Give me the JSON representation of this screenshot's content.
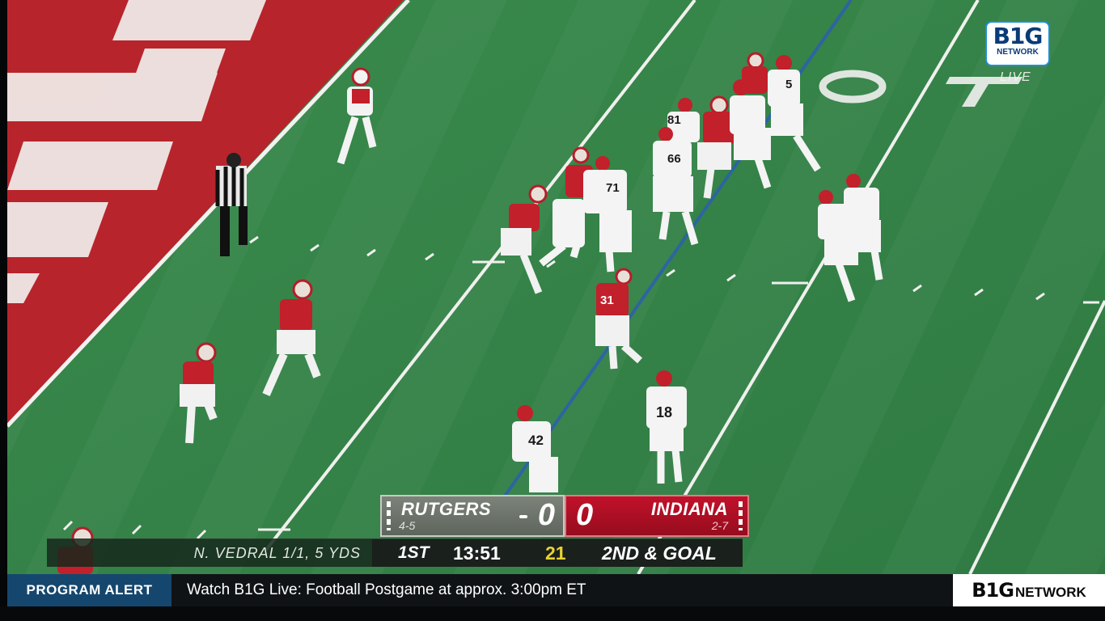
{
  "scorebug": {
    "away": {
      "name": "RUTGERS",
      "record": "4-5",
      "score": "0"
    },
    "home": {
      "name": "INDIANA",
      "record": "2-7",
      "score": "0"
    },
    "quarter": "1ST",
    "clock": "13:51",
    "play_clock": "21",
    "down_distance": "2ND & GOAL",
    "stat_line": "N. VEDRAL 1/1, 5 YDS"
  },
  "network": {
    "logo_main": "B1G",
    "logo_sub": "NETWORK",
    "live_label": "LIVE"
  },
  "ticker": {
    "label": "PROGRAM ALERT",
    "message": "Watch B1G Live: Football Postgame at approx. 3:00pm ET",
    "logo_main": "B1G",
    "logo_sub": "NETWORK"
  },
  "field": {
    "endzone_color": "#b8242c",
    "turf_color": "#3d8a4f",
    "yard_number": "10",
    "jersey_numbers": [
      "81",
      "71",
      "66",
      "5",
      "31",
      "42",
      "18"
    ]
  },
  "colors": {
    "rutgers": "#6b7368",
    "indiana": "#b3122a",
    "play_clock": "#e8d332",
    "ticker_label": "#15476e"
  }
}
